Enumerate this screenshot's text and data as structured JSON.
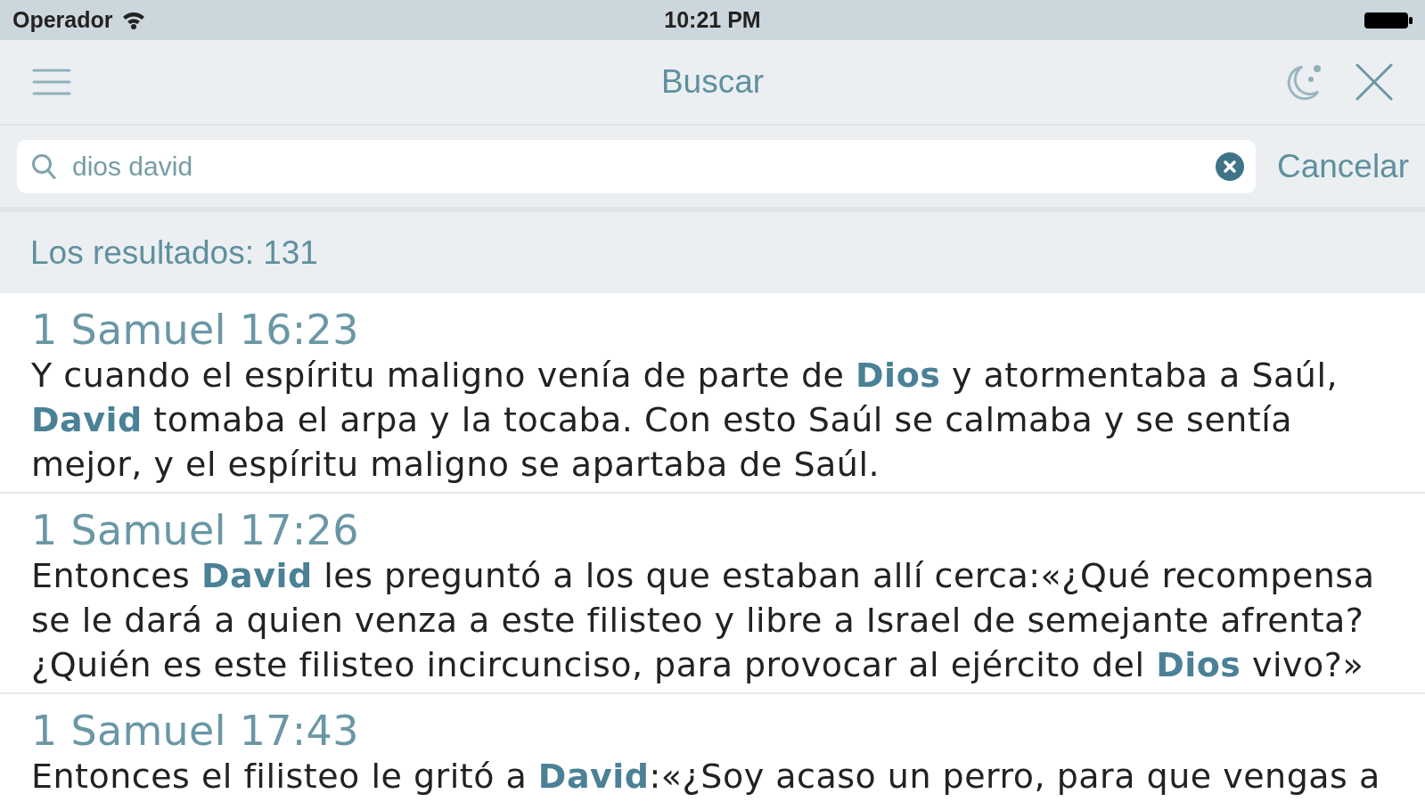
{
  "status_bar": {
    "carrier": "Operador",
    "time": "10:21 PM"
  },
  "nav_bar": {
    "title": "Buscar"
  },
  "search": {
    "value": "dios david",
    "cancel_label": "Cancelar"
  },
  "results_header": "Los resultados: 131",
  "results": [
    {
      "reference": "1 Samuel 16:23",
      "text": "Y cuando el espíritu maligno venía de parte de **Dios** y atormentaba a Saúl, **David** tomaba el arpa y la tocaba. Con esto Saúl se calmaba y se sentía mejor, y el espíritu maligno se apartaba de Saúl."
    },
    {
      "reference": "1 Samuel 17:26",
      "text": "Entonces **David** les preguntó a los que estaban allí cerca:«¿Qué recompensa se le dará a quien venza a este filisteo y libre a Israel de semejante afrenta? ¿Quién es este filisteo incircunciso, para provocar al ejército del **Dios** vivo?»"
    },
    {
      "reference": "1 Samuel 17:43",
      "text": "Entonces el filisteo le gritó a **David**:«¿Soy acaso un perro, para que vengas a"
    }
  ]
}
